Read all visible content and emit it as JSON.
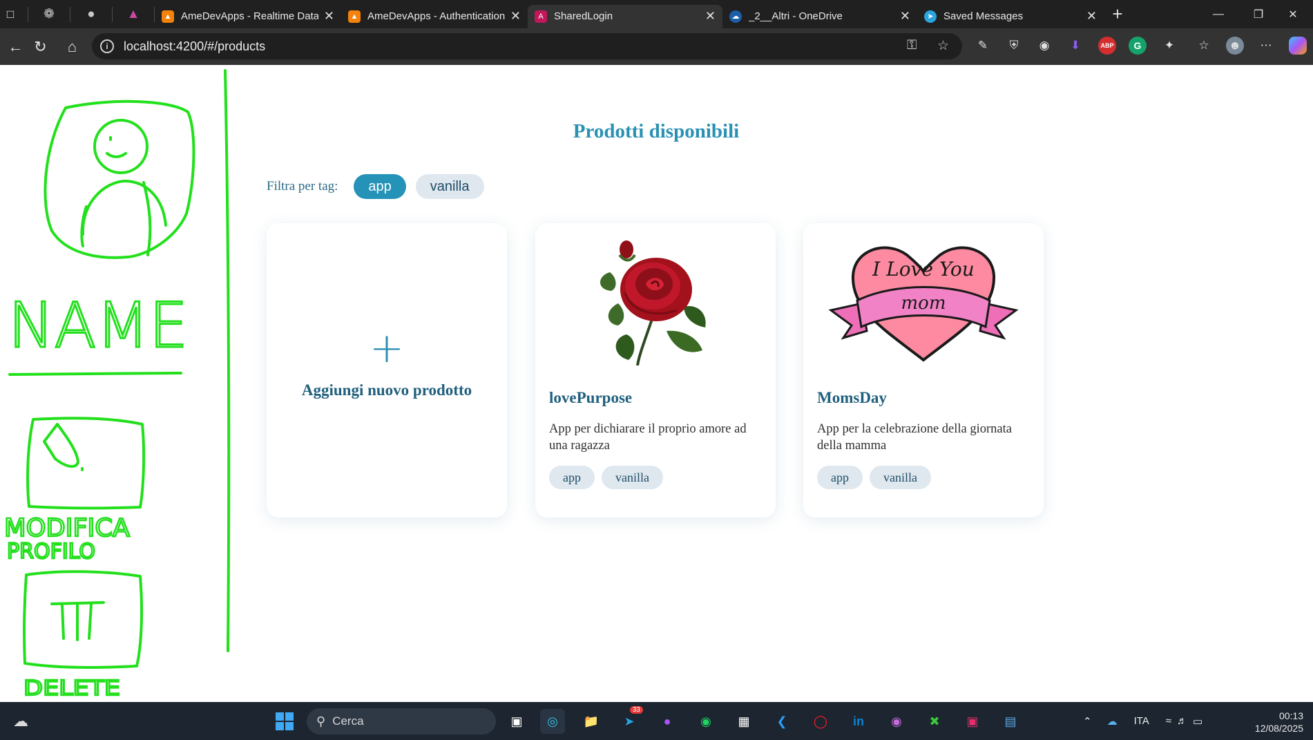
{
  "tabs": [
    {
      "title": "AmeDevApps - Realtime Datab",
      "icon": "firebase-icon"
    },
    {
      "title": "AmeDevApps - Authentication",
      "icon": "firebase-icon"
    },
    {
      "title": "SharedLogin",
      "icon": "angular-icon",
      "active": true
    },
    {
      "title": "_2__Altri - OneDrive",
      "icon": "onedrive-icon"
    },
    {
      "title": "Saved Messages",
      "icon": "telegram-icon"
    }
  ],
  "address": {
    "url": "localhost:4200/#/products"
  },
  "extensions": {
    "abp_label": "ABP",
    "grammarly_label": "G"
  },
  "page": {
    "title": "Prodotti disponibili",
    "filter_label": "Filtra per tag:",
    "filter_tags": [
      "app",
      "vanilla"
    ],
    "active_filter": "app",
    "add_card_label": "Aggiungi nuovo prodotto",
    "products": [
      {
        "name": "lovePurpose",
        "description": "App per dichiarare il proprio amore ad una ragazza",
        "tags": [
          "app",
          "vanilla"
        ],
        "image": "rose-image"
      },
      {
        "name": "MomsDay",
        "description": "App per la celebrazione della giornata della mamma",
        "tags": [
          "app",
          "vanilla"
        ],
        "image": "heart-i-love-you-mom-image",
        "image_text_line1": "I Love You",
        "image_text_line2": "mom"
      }
    ]
  },
  "sketch": {
    "name_text": "NAME",
    "edit_profile_text_1": "MODIFICA",
    "edit_profile_text_2": "PROFILO",
    "delete_text": "DELETE"
  },
  "taskbar": {
    "search_placeholder": "Cerca",
    "telegram_badge": "33",
    "language": "ITA",
    "time": "00:13",
    "date": "12/08/2025"
  },
  "colors": {
    "accent": "#2592b8",
    "title": "#2a91b4",
    "sketch_green": "#22e01c",
    "chip_bg": "#dfe7ef"
  }
}
